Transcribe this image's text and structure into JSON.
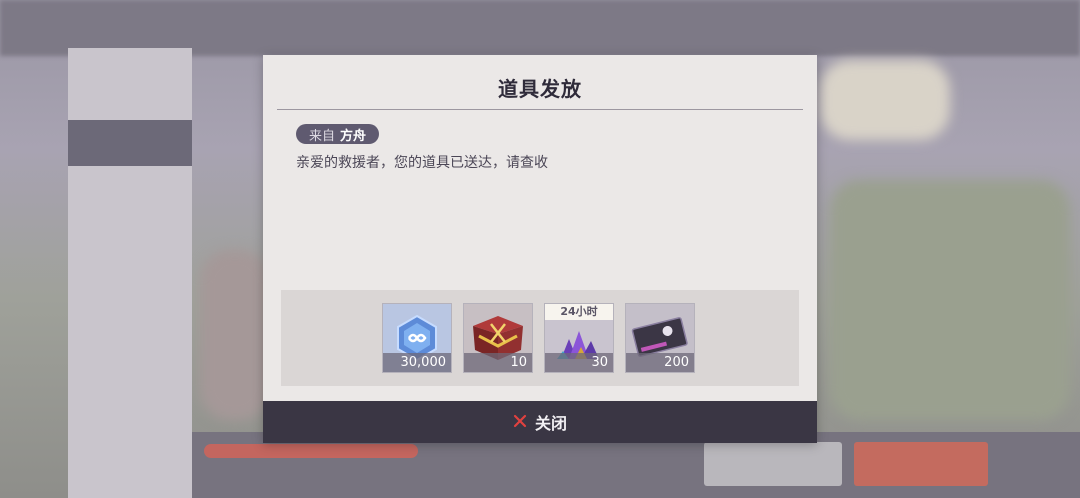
{
  "dialog": {
    "title": "道具发放",
    "sender": {
      "prefix": "来自",
      "name": "方舟"
    },
    "message": "亲爱的救援者，您的道具已送达，请查收",
    "items": [
      {
        "icon": "crystal-hexagon-icon",
        "count": "30,000",
        "tag": ""
      },
      {
        "icon": "red-chest-icon",
        "count": "10",
        "tag": ""
      },
      {
        "icon": "purple-gem-pile-icon",
        "count": "30",
        "tag": "24小时"
      },
      {
        "icon": "dark-ticket-card-icon",
        "count": "200",
        "tag": ""
      }
    ],
    "close_label": "关闭"
  },
  "colors": {
    "dialog_bg": "#ebe8e7",
    "close_bar": "#3a3644",
    "close_icon": "#e0413f",
    "badge": "#5f5a70"
  }
}
